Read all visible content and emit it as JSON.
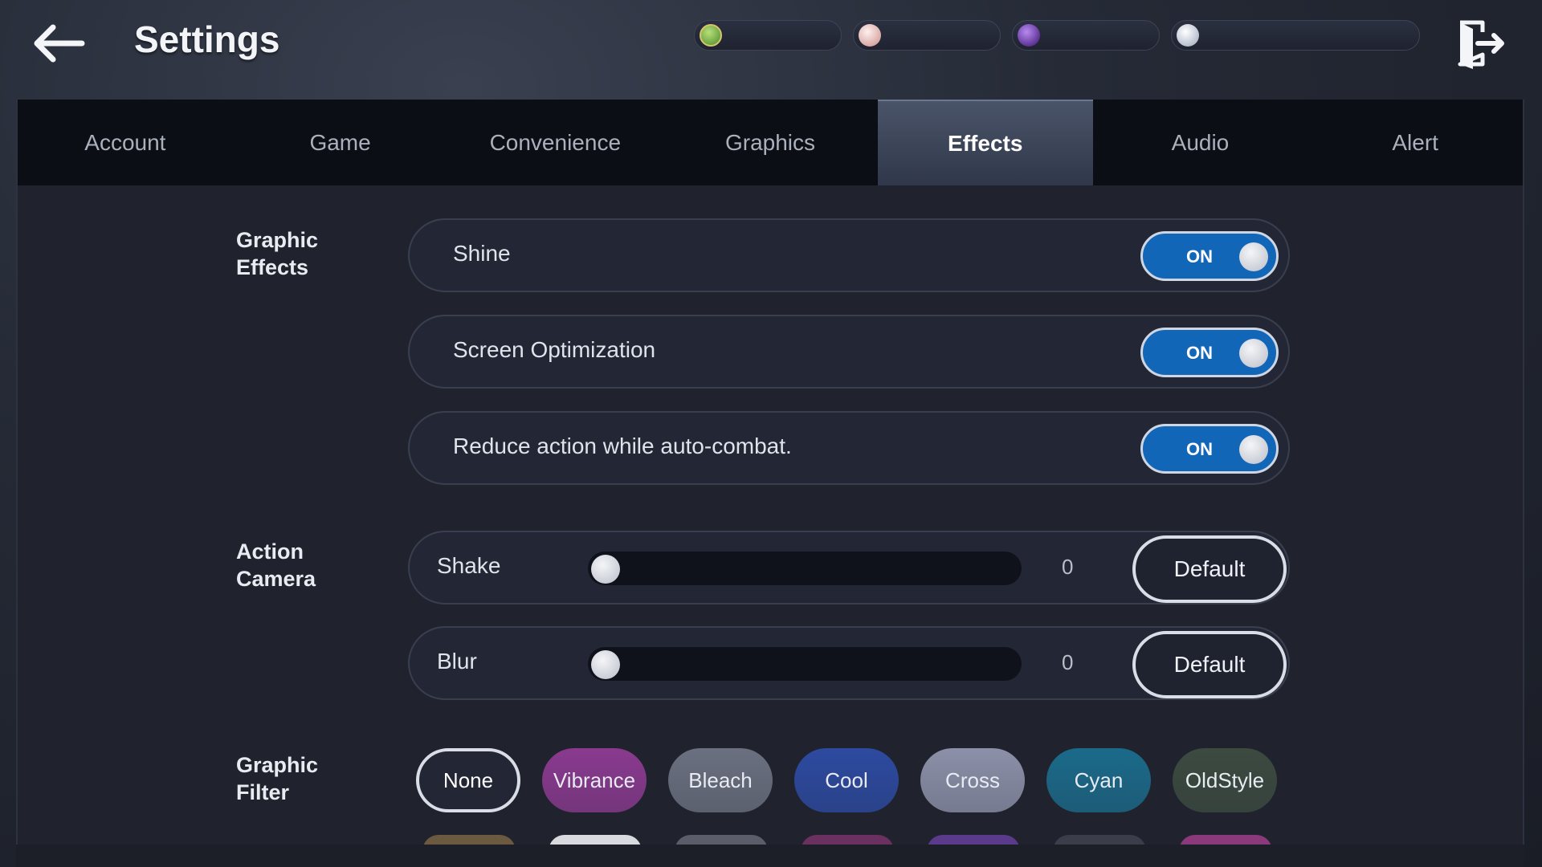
{
  "header": {
    "title": "Settings",
    "back_icon": "arrow-left-icon",
    "exit_icon": "exit-door-icon",
    "currencies": [
      {
        "icon": "green-gem-icon",
        "amount": "",
        "color": "#6fae3a"
      },
      {
        "icon": "pink-pearl-icon",
        "amount": "",
        "color": "#e7b7b4"
      },
      {
        "icon": "purple-orb-icon",
        "amount": "",
        "color": "#6a2fb0"
      },
      {
        "icon": "silver-coin-icon",
        "amount": "",
        "color": "#c9d4e2"
      }
    ]
  },
  "tabs": [
    {
      "label": "Account",
      "active": false
    },
    {
      "label": "Game",
      "active": false
    },
    {
      "label": "Convenience",
      "active": false
    },
    {
      "label": "Graphics",
      "active": false
    },
    {
      "label": "Effects",
      "active": true
    },
    {
      "label": "Audio",
      "active": false
    },
    {
      "label": "Alert",
      "active": false
    }
  ],
  "graphic_effects": {
    "section_label": "Graphic\nEffects",
    "items": [
      {
        "label": "Shine",
        "toggle": "ON"
      },
      {
        "label": "Screen Optimization",
        "toggle": "ON"
      },
      {
        "label": "Reduce action while auto-combat.",
        "toggle": "ON"
      }
    ]
  },
  "action_camera": {
    "section_label": "Action\nCamera",
    "sliders": [
      {
        "label": "Shake",
        "value": "0",
        "level": 0,
        "button": "Default"
      },
      {
        "label": "Blur",
        "value": "0",
        "level": 0,
        "button": "Default"
      }
    ]
  },
  "graphic_filter": {
    "section_label": "Graphic\nFilter",
    "selected": "None",
    "options": [
      {
        "label": "None",
        "color": "#232735"
      },
      {
        "label": "Vibrance",
        "color": "#8a3a8f"
      },
      {
        "label": "Bleach",
        "color": "#6b7080"
      },
      {
        "label": "Cool",
        "color": "#2d4aa0"
      },
      {
        "label": "Cross",
        "color": "#8c90a8"
      },
      {
        "label": "Cyan",
        "color": "#1b6a8a"
      },
      {
        "label": "OldStyle",
        "color": "#3c4a40"
      }
    ],
    "second_row_colors": [
      "#6b5a40",
      "#d8dae0",
      "#5a5e6a",
      "#6a3060",
      "#5a3a8a",
      "#3a3e4a",
      "#8a3a7a"
    ]
  },
  "colors": {
    "toggle_on": "#1266b8",
    "active_tab": "#3a4358",
    "panel_bg": "#20232e"
  }
}
